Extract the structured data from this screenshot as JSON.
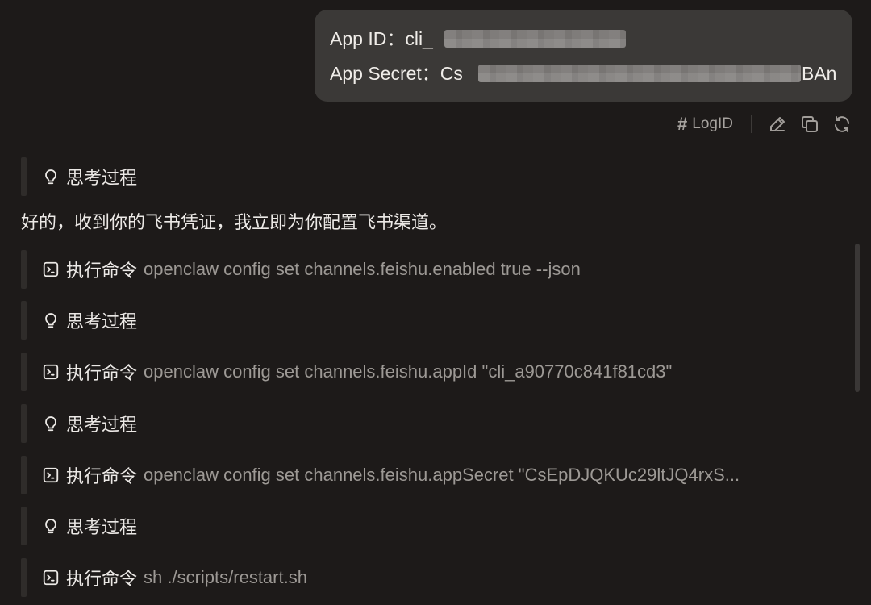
{
  "user_message": {
    "app_id_label": "App ID：",
    "app_id_prefix": "cli_",
    "app_secret_label": "App Secret：",
    "app_secret_prefix": "Cs",
    "app_secret_suffix": "BAn"
  },
  "actions": {
    "logid_label": "LogID",
    "icons": [
      "edit-icon",
      "copy-icon",
      "refresh-icon"
    ]
  },
  "reply_text": "好的，收到你的飞书凭证，我立即为你配置飞书渠道。",
  "thinking_label": "思考过程",
  "steps": [
    {
      "type": "thinking",
      "label": "思考过程"
    },
    {
      "type": "exec",
      "label": "执行命令",
      "command": "openclaw config set channels.feishu.enabled true --json"
    },
    {
      "type": "thinking",
      "label": "思考过程"
    },
    {
      "type": "exec",
      "label": "执行命令",
      "command": "openclaw config set channels.feishu.appId \"cli_a90770c841f81cd3\""
    },
    {
      "type": "thinking",
      "label": "思考过程"
    },
    {
      "type": "exec",
      "label": "执行命令",
      "command": "openclaw config set channels.feishu.appSecret \"CsEpDJQKUc29ltJQ4rxS..."
    },
    {
      "type": "thinking",
      "label": "思考过程"
    },
    {
      "type": "exec",
      "label": "执行命令",
      "command": "sh ./scripts/restart.sh"
    }
  ]
}
